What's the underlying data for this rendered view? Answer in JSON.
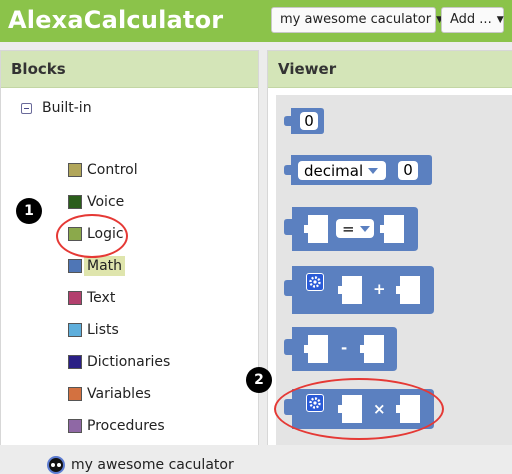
{
  "header": {
    "app_title": "AlexaCalculator",
    "project_dropdown": "my awesome caculator",
    "add_button": "Add ..."
  },
  "blocks_panel": {
    "title": "Blocks",
    "tree_root": "Built-in",
    "categories": [
      {
        "label": "Control",
        "color": "#b1a65a"
      },
      {
        "label": "Voice",
        "color": "#2b5e1b"
      },
      {
        "label": "Logic",
        "color": "#8ba94b"
      },
      {
        "label": "Math",
        "color": "#4f76b6",
        "selected": true
      },
      {
        "label": "Text",
        "color": "#b3406e"
      },
      {
        "label": "Lists",
        "color": "#5eaedb"
      },
      {
        "label": "Dictionaries",
        "color": "#2a1f85"
      },
      {
        "label": "Variables",
        "color": "#d37140"
      },
      {
        "label": "Procedures",
        "color": "#8f68a5"
      }
    ],
    "project_item": "my awesome caculator"
  },
  "viewer": {
    "title": "Viewer",
    "blocks": {
      "number_value": "0",
      "decimal_label": "decimal",
      "decimal_value": "0",
      "compare_op": "=",
      "add_op": "+",
      "subtract_op": "-",
      "multiply_op": "×"
    },
    "block_color": "#5b80c0"
  },
  "annotations": {
    "marker_1": "1",
    "marker_2": "2"
  }
}
